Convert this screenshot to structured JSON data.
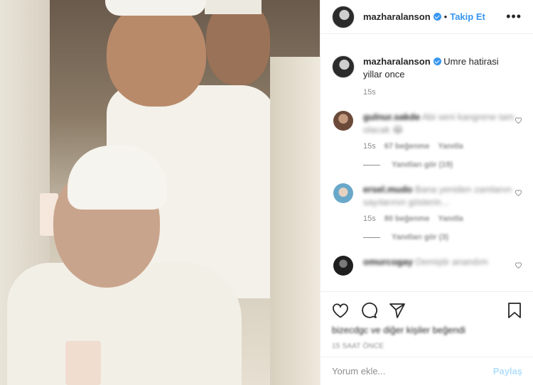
{
  "post": {
    "username": "mazharalanson",
    "follow_label": "Takip Et",
    "separator": "•",
    "more_label": "•••"
  },
  "caption": {
    "username": "mazharalanson",
    "text": "Umre hatirasi yillar once",
    "time": "15s"
  },
  "comments": [
    {
      "username": "gulnur.sakde",
      "text": "Abi seni kangrene tam olacak 😂",
      "time": "15s",
      "likes": "67 beğenme",
      "reply_label": "Yanıtla",
      "view_replies": "Yanıtları gör (19)",
      "avatar_color": "#6b4a3a"
    },
    {
      "username": "ersel.mudo",
      "text": "Bana yeniden zamlanın sayılarının gösterin...",
      "time": "15s",
      "likes": "80 beğenme",
      "reply_label": "Yanıtla",
      "view_replies": "Yanıtları gör (3)",
      "avatar_color": "#6aa8c9"
    },
    {
      "username": "omurcogay",
      "text": "Demiştir anandım",
      "avatar_color": "#1f1f1f"
    }
  ],
  "actions": {
    "likes_text": "bizecdgc ve diğer kişiler beğendi",
    "post_time": "15 saat önce"
  },
  "add_comment": {
    "placeholder": "Yorum ekle...",
    "share_label": "Paylaş"
  },
  "colors": {
    "link_blue": "#3897f0",
    "share_disabled": "#b2dffc",
    "muted": "#8e8e8e"
  }
}
